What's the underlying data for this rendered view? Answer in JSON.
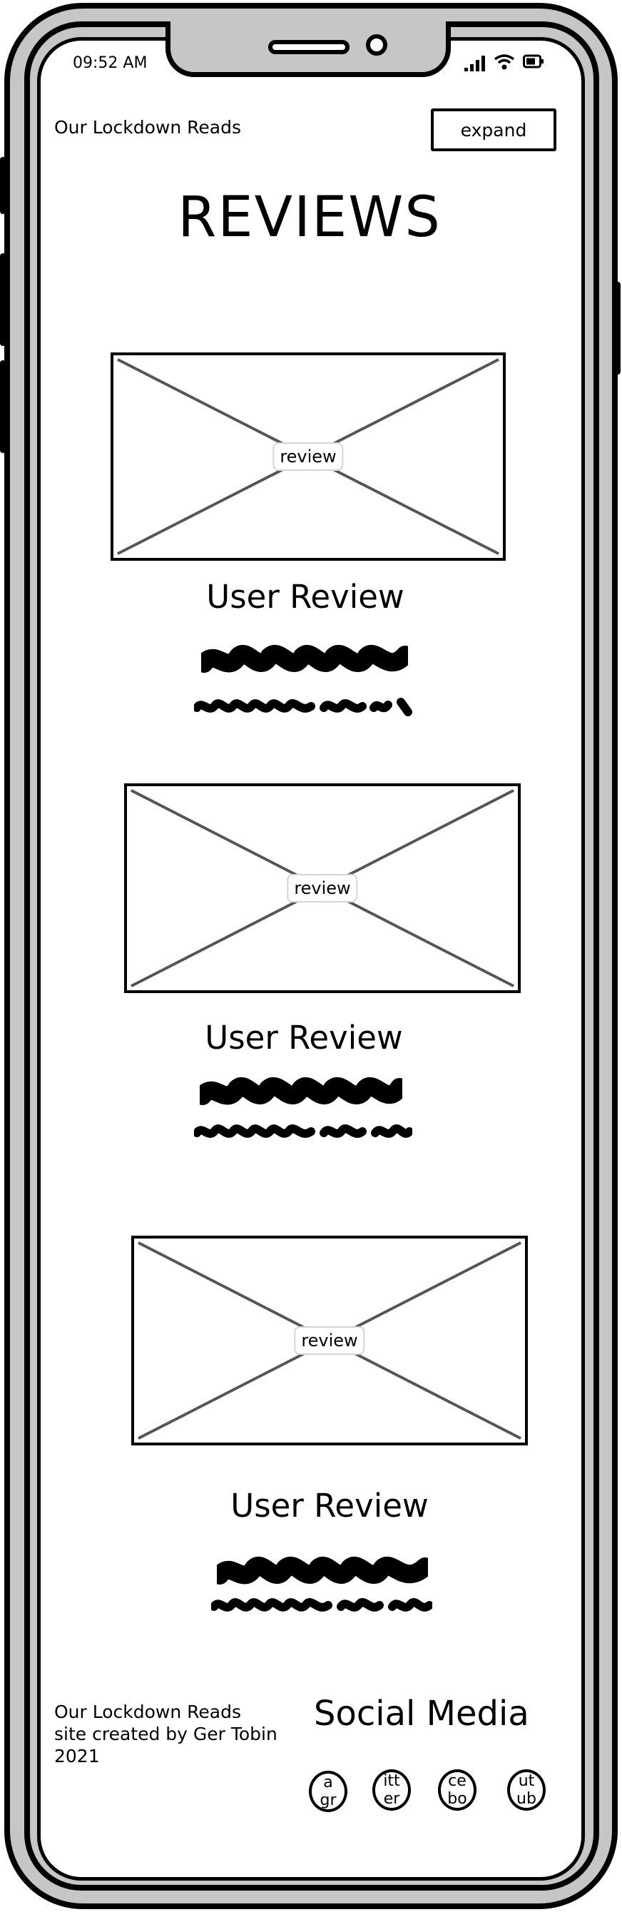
{
  "status_bar": {
    "time": "09:52 AM"
  },
  "header": {
    "site_title": "Our Lockdown Reads",
    "expand_label": "expand"
  },
  "page": {
    "title": "REVIEWS"
  },
  "reviews": [
    {
      "image_label": "review",
      "title": "User Review"
    },
    {
      "image_label": "review",
      "title": "User Review"
    },
    {
      "image_label": "review",
      "title": "User Review"
    }
  ],
  "footer": {
    "lines": [
      "Our Lockdown Reads",
      "site created by Ger Tobin",
      "2021"
    ],
    "social_title": "Social Media",
    "social_icons": [
      {
        "name": "instagram-icon",
        "line1": "a",
        "line2": "gr"
      },
      {
        "name": "twitter-icon",
        "line1": "itt",
        "line2": "er"
      },
      {
        "name": "facebook-icon",
        "line1": "ce",
        "line2": "bo"
      },
      {
        "name": "youtube-icon",
        "line1": "ut",
        "line2": "ub"
      }
    ]
  }
}
